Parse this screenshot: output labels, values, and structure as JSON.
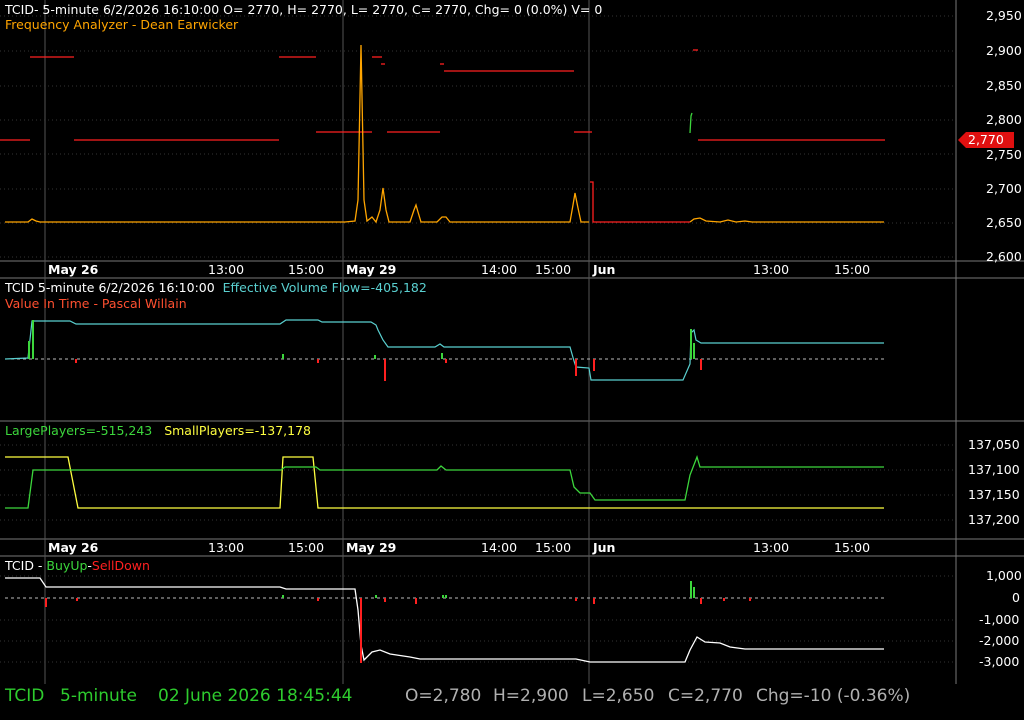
{
  "colors": {
    "bg": "#000000",
    "grid": "#3a3a3a",
    "axis_text": "#ffffff",
    "orange": "#ffa500",
    "red": "#ff2020",
    "cyan": "#5ad0d0",
    "green": "#3cd63c",
    "yellow": "#ffff40",
    "white": "#ffffff",
    "footer_green": "#2ecc2e",
    "footer_gray": "#b0b0b0"
  },
  "panel1": {
    "header_line1": "TCID- 5-minute 6/2/2026 16:10:00 O= 2770, H= 2770, L= 2770, C= 2770, Chg= 0 (0.0%) V= 0",
    "header_line2": "Frequency Analyzer - Dean Earwicker",
    "y_ticks": [
      "2,950",
      "2,900",
      "2,850",
      "2,800",
      "2,750",
      "2,700",
      "2,650",
      "2,600"
    ],
    "last_price": "2,770"
  },
  "x_axis": [
    "May 26",
    "13:00",
    "15:00",
    "May 29",
    "14:00",
    "15:00",
    "Jun",
    "13:00",
    "15:00"
  ],
  "panel2": {
    "title_prefix": "TCID 5-minute 6/2/2026 16:10:00",
    "title_evf": "Effective Volume Flow=-405,182",
    "subtitle": "Value In Time - Pascal Willain"
  },
  "panel3": {
    "large_players": "LargePlayers=-515,243",
    "small_players": "SmallPlayers=-137,178",
    "y_ticks": [
      "137,050",
      "137,100",
      "137,150",
      "137,200"
    ]
  },
  "panel4": {
    "title_prefix": "TCID -",
    "buy_up": "BuyUp",
    "dash": "-",
    "sell_down": "SellDown",
    "y_ticks": [
      "1,000",
      "0",
      "-1,000",
      "-2,000",
      "-3,000"
    ]
  },
  "footer": {
    "symbol": "TCID",
    "interval": "5-minute",
    "datetime": "02 June 2026 18:45:44",
    "open": "O=2,780",
    "high": "H=2,900",
    "low": "L=2,650",
    "close": "C=2,770",
    "change": "Chg=-10 (-0.36%)"
  }
}
